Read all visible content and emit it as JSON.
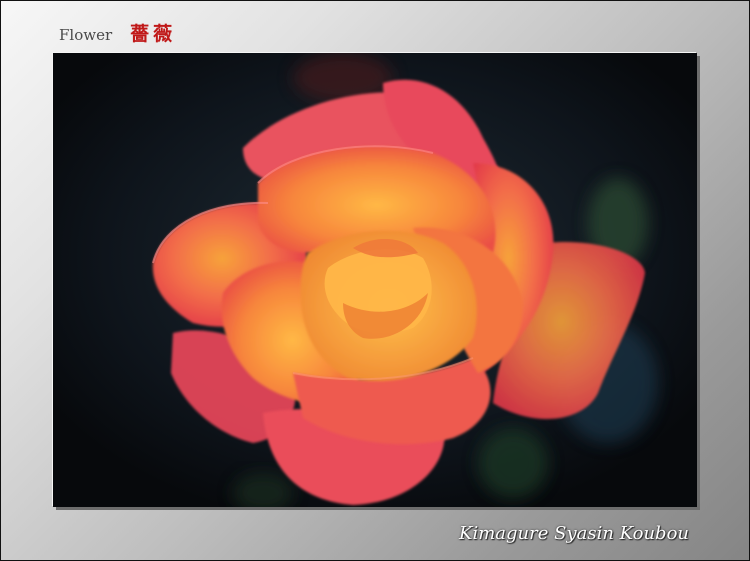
{
  "header": {
    "category": "Flower",
    "title_jp": "薔薇"
  },
  "photo": {
    "subject": "rose-flower",
    "colors": {
      "petal_outer": "#e8454f",
      "petal_mid": "#f26b4a",
      "petal_center": "#f7a23a",
      "background": "#0d1118",
      "leaf": "#27402a"
    }
  },
  "signature": "Kimagure Syasin Koubou"
}
